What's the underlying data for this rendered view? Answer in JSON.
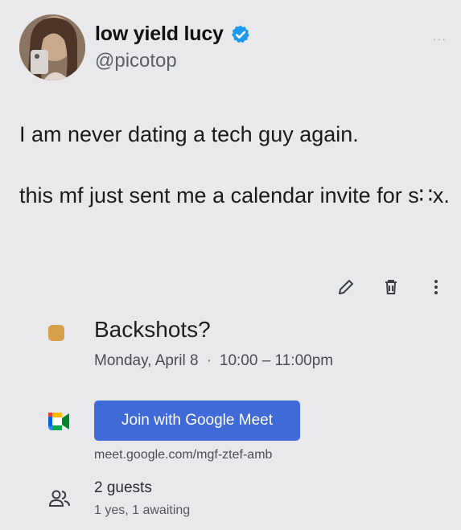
{
  "tweet": {
    "display_name": "low yield lucy",
    "handle": "@picotop",
    "more_icon": "more-dots-icon",
    "lines": [
      "I am never dating a tech guy again.",
      "this mf just sent me a calendar invite for s∷x."
    ]
  },
  "event": {
    "toolbar_icons": [
      "edit-pencil-icon",
      "delete-trash-icon",
      "more-vertical-icon"
    ],
    "color": "#d7a04a",
    "title": "Backshots?",
    "date": "Monday, April 8",
    "separator": "·",
    "time": "10:00 – 11:00pm",
    "meet_button": "Join with Google Meet",
    "meet_link": "meet.google.com/mgf-ztef-amb",
    "guests_count": "2 guests",
    "guests_status": "1 yes, 1 awaiting"
  },
  "colors": {
    "background": "#e9e9eb",
    "verified_badge": "#1d9bf0",
    "meet_button": "#3f6ad8"
  }
}
